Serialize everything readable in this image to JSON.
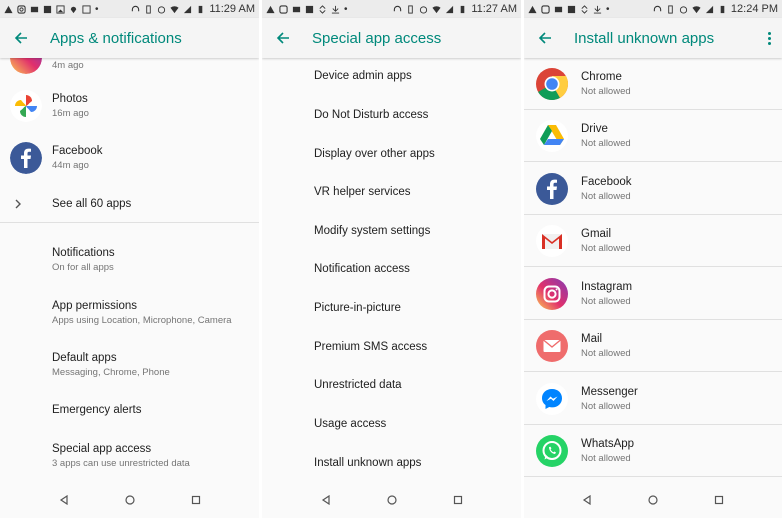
{
  "panels": {
    "apps": {
      "time": "11:29 AM",
      "title": "Apps & notifications",
      "partial_item_sub": "4m ago",
      "recent_apps": [
        {
          "name": "Photos",
          "sub": "16m ago"
        },
        {
          "name": "Facebook",
          "sub": "44m ago"
        }
      ],
      "see_all": "See all 60 apps",
      "settings": [
        {
          "title": "Notifications",
          "sub": "On for all apps"
        },
        {
          "title": "App permissions",
          "sub": "Apps using Location, Microphone, Camera"
        },
        {
          "title": "Default apps",
          "sub": "Messaging, Chrome, Phone"
        },
        {
          "title": "Emergency alerts",
          "sub": ""
        },
        {
          "title": "Special app access",
          "sub": "3 apps can use unrestricted data"
        }
      ]
    },
    "special": {
      "time": "11:27 AM",
      "title": "Special app access",
      "items": [
        "Device admin apps",
        "Do Not Disturb access",
        "Display over other apps",
        "VR helper services",
        "Modify system settings",
        "Notification access",
        "Picture-in-picture",
        "Premium SMS access",
        "Unrestricted data",
        "Usage access",
        "Install unknown apps"
      ]
    },
    "install": {
      "time": "12:24 PM",
      "title": "Install unknown apps",
      "apps": [
        {
          "name": "Chrome",
          "sub": "Not allowed",
          "icon": "chrome-icon"
        },
        {
          "name": "Drive",
          "sub": "Not allowed",
          "icon": "drive-icon"
        },
        {
          "name": "Facebook",
          "sub": "Not allowed",
          "icon": "facebook-icon"
        },
        {
          "name": "Gmail",
          "sub": "Not allowed",
          "icon": "gmail-icon"
        },
        {
          "name": "Instagram",
          "sub": "Not allowed",
          "icon": "instagram-icon"
        },
        {
          "name": "Mail",
          "sub": "Not allowed",
          "icon": "mail-icon"
        },
        {
          "name": "Messenger",
          "sub": "Not allowed",
          "icon": "messenger-icon"
        },
        {
          "name": "WhatsApp",
          "sub": "Not allowed",
          "icon": "whatsapp-icon"
        }
      ]
    }
  },
  "colors": {
    "accent": "#00897b",
    "divider": "#e0e0e0",
    "secondary_text": "#757575"
  }
}
